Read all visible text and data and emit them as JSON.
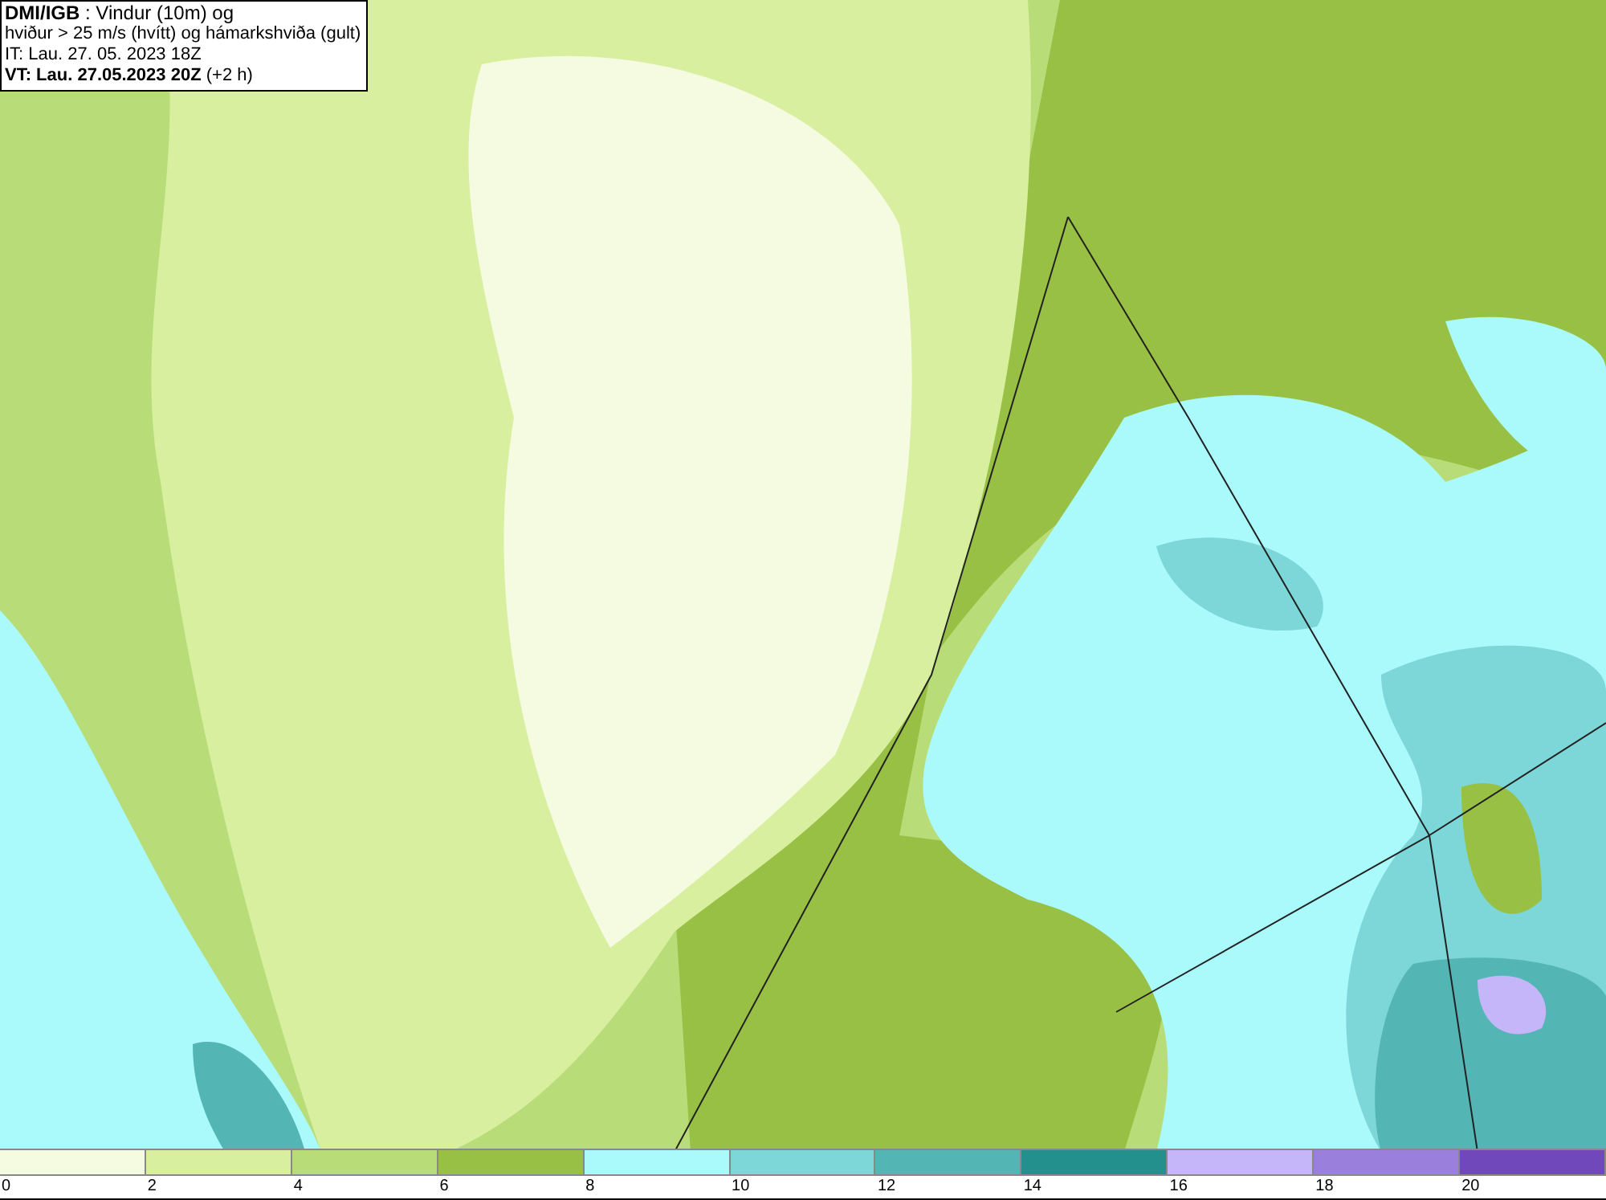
{
  "header": {
    "lines": [
      "**DMI/IGB** : Vindur (10m) og",
      "hviður > 25 m/s (hvítt) og hámarkshviða (gult)",
      "IT: Lau. 27. 05. 2023 18Z",
      "**VT: Lau. 27.05.2023 20Z** (+2 h)"
    ]
  },
  "legend": {
    "bins": [
      {
        "color": "#f5fbe0",
        "label": "0"
      },
      {
        "color": "#d7ef9f",
        "label": "2"
      },
      {
        "color": "#b8dc77",
        "label": "4"
      },
      {
        "color": "#98c044",
        "label": "6"
      },
      {
        "color": "#aaf9fb",
        "label": "8"
      },
      {
        "color": "#7dd7d8",
        "label": "10"
      },
      {
        "color": "#53b6b5",
        "label": "12"
      },
      {
        "color": "#24908d",
        "label": "14"
      },
      {
        "color": "#c4b6f9",
        "label": "16"
      },
      {
        "color": "#9a80dc",
        "label": "18"
      },
      {
        "color": "#7048bb",
        "label": "20"
      }
    ]
  }
}
